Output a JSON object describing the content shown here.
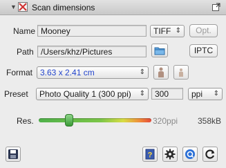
{
  "title": "Scan dimensions",
  "name": {
    "label": "Name",
    "value": "Mooney",
    "format": "TIFF",
    "options_button": "Opt."
  },
  "path": {
    "label": "Path",
    "value": "/Users/khz/Pictures",
    "iptc_button": "IPTC"
  },
  "format": {
    "label": "Format",
    "value": "3.63 x 2.41 cm"
  },
  "preset": {
    "label": "Preset",
    "value": "Photo Quality 1 (300 ppi)",
    "resolution": "300",
    "unit": "ppi"
  },
  "res": {
    "label": "Res.",
    "value_text": "320ppi",
    "size_text": "358kB",
    "level": 0.27
  },
  "colors": {
    "format_text": "#2244cc",
    "accent": "#2a6fd6"
  }
}
